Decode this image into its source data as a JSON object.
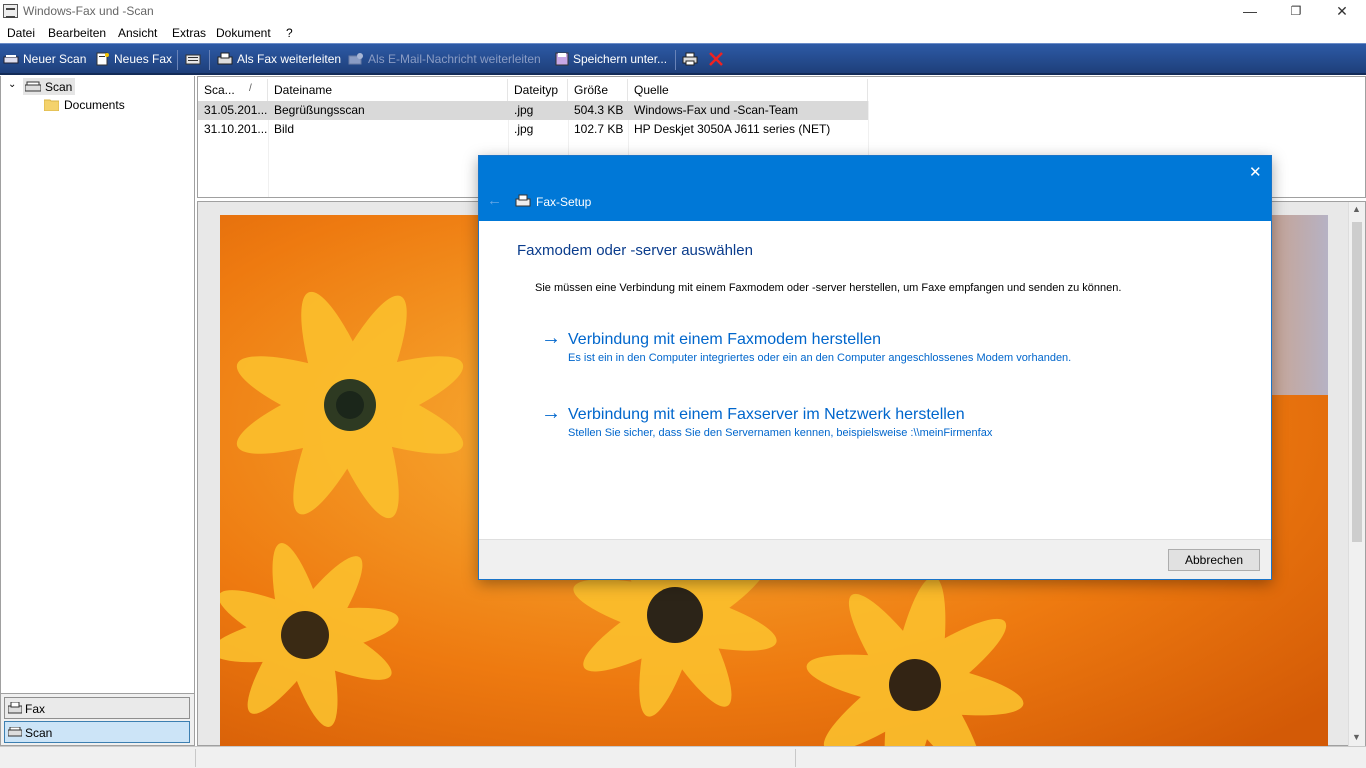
{
  "window": {
    "title": "Windows-Fax und -Scan",
    "minimize": "—",
    "maximize": "❐",
    "close": "✕"
  },
  "menu": [
    "Datei",
    "Bearbeiten",
    "Ansicht",
    "Extras",
    "Dokument",
    "?"
  ],
  "toolbar": {
    "new_scan": "Neuer Scan",
    "new_fax": "Neues Fax",
    "forward_fax": "Als Fax weiterleiten",
    "forward_email": "Als E-Mail-Nachricht weiterleiten",
    "save_as": "Speichern unter..."
  },
  "tree": {
    "root": "Scan",
    "child": "Documents"
  },
  "nav": {
    "fax": "Fax",
    "scan": "Scan"
  },
  "list": {
    "columns": [
      "Sca...",
      "Dateiname",
      "Dateityp",
      "Größe",
      "Quelle"
    ],
    "rows": [
      [
        "31.05.201...",
        "Begrüßungsscan",
        ".jpg",
        "504.3 KB",
        "Windows-Fax und -Scan-Team"
      ],
      [
        "31.10.201...",
        "Bild",
        ".jpg",
        "102.7 KB",
        "HP Deskjet 3050A J611 series (NET)"
      ]
    ]
  },
  "dialog": {
    "header_title": "Fax-Setup",
    "heading": "Faxmodem oder -server auswählen",
    "intro": "Sie müssen eine Verbindung mit einem Faxmodem oder -server herstellen, um Faxe empfangen und senden zu können.",
    "options": [
      {
        "title": "Verbindung mit einem Faxmodem herstellen",
        "desc": "Es ist ein in den Computer integriertes oder ein an den Computer angeschlossenes Modem vorhanden."
      },
      {
        "title": "Verbindung mit einem Faxserver im Netzwerk herstellen",
        "desc": "Stellen Sie sicher, dass Sie den Servernamen kennen, beispielsweise :\\\\meinFirmenfax"
      }
    ],
    "cancel": "Abbrechen"
  },
  "colors": {
    "toolbar": "#2d5aa6",
    "dialog_header": "#0078d7",
    "link": "#0066cc"
  }
}
